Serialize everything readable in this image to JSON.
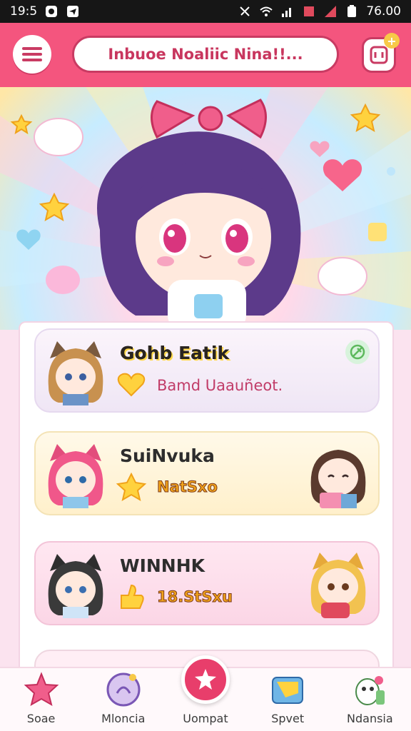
{
  "status_bar": {
    "time": "19:5",
    "battery_text": "76.00"
  },
  "header": {
    "title": "Inbuoe Noaliic Nina!!..."
  },
  "list": [
    {
      "name": "Gohb Eatik",
      "subtitle": "Bamd Uaauñeot."
    },
    {
      "name": "SuiNvuka",
      "subtitle": "NatSxo"
    },
    {
      "name": "WINNHK",
      "subtitle": "18.StSxu"
    }
  ],
  "bottom_nav": [
    {
      "label": "Soae",
      "icon": "star-icon"
    },
    {
      "label": "Mloncia",
      "icon": "chat-icon"
    },
    {
      "label": "Uompat",
      "icon": "sparkle-icon"
    },
    {
      "label": "Spvet",
      "icon": "folder-icon"
    },
    {
      "label": "Ndansia",
      "icon": "dino-icon"
    }
  ],
  "colors": {
    "header": "#f4557e",
    "accent": "#e83e6b",
    "background": "#fbe3ef"
  }
}
